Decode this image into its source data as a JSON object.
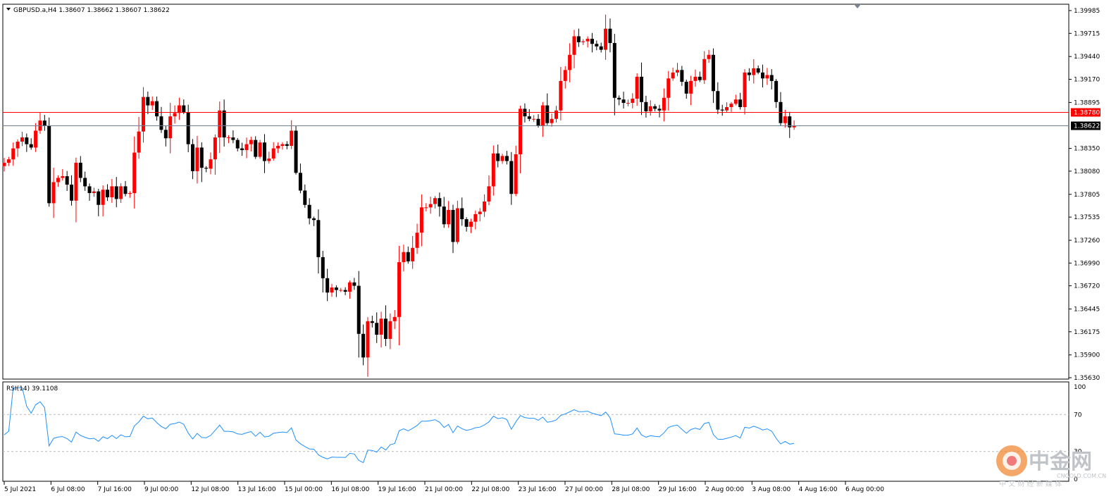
{
  "header": {
    "symbol_line": "GBPUSD.a,H4  1.38607 1.38662 1.38607 1.38622"
  },
  "colors": {
    "bull": "#ff0000",
    "bear": "#000000",
    "hline_red": "#ff0000",
    "hline_bid": "#708090",
    "rsi_line": "#1e90ff",
    "price_tag_red_bg": "#ff0000",
    "price_tag_dark_bg": "#000000"
  },
  "chart_data": {
    "type": "candlestick",
    "title": "GBPUSD.a,H4",
    "ohlc_header": [
      1.38607,
      1.38662,
      1.38607,
      1.38622
    ],
    "ylim": [
      1.3563,
      1.39985
    ],
    "price_ticks": [
      "1.39985",
      "1.39715",
      "1.39440",
      "1.39170",
      "1.38895",
      "1.38350",
      "1.38080",
      "1.37805",
      "1.37535",
      "1.37260",
      "1.36990",
      "1.36720",
      "1.36445",
      "1.36175",
      "1.35900",
      "1.35630"
    ],
    "horizontal_lines": [
      {
        "price": 1.3878,
        "label": "1.38780",
        "color": "red"
      },
      {
        "price": 1.38622,
        "label": "1.38622",
        "color": "bid"
      }
    ],
    "x_ticks": [
      "5 Jul 2021",
      "6 Jul 08:00",
      "7 Jul 16:00",
      "9 Jul 00:00",
      "12 Jul 08:00",
      "13 Jul 16:00",
      "15 Jul 00:00",
      "16 Jul 08:00",
      "19 Jul 16:00",
      "21 Jul 00:00",
      "22 Jul 08:00",
      "23 Jul 16:00",
      "27 Jul 00:00",
      "28 Jul 08:00",
      "29 Jul 16:00",
      "2 Aug 00:00",
      "3 Aug 08:00",
      "4 Aug 16:00",
      "6 Aug 00:00"
    ],
    "closes": [
      1.3818,
      1.3822,
      1.3835,
      1.3843,
      1.3848,
      1.384,
      1.3836,
      1.3856,
      1.3868,
      1.3862,
      1.377,
      1.3795,
      1.38,
      1.3802,
      1.3792,
      1.3773,
      1.3818,
      1.38,
      1.379,
      1.3782,
      1.3784,
      1.3768,
      1.3786,
      1.3777,
      1.379,
      1.3775,
      1.379,
      1.3781,
      1.3782,
      1.383,
      1.3855,
      1.3896,
      1.3886,
      1.3891,
      1.3873,
      1.3857,
      1.3847,
      1.3873,
      1.3877,
      1.3886,
      1.3878,
      1.384,
      1.3808,
      1.3836,
      1.3812,
      1.3811,
      1.3822,
      1.3848,
      1.388,
      1.3848,
      1.3848,
      1.3845,
      1.3835,
      1.3833,
      1.384,
      1.3845,
      1.3825,
      1.3842,
      1.382,
      1.3823,
      1.3835,
      1.3838,
      1.384,
      1.3838,
      1.3856,
      1.3806,
      1.3785,
      1.3768,
      1.3752,
      1.375,
      1.3706,
      1.3681,
      1.3664,
      1.367,
      1.3667,
      1.3667,
      1.3665,
      1.3676,
      1.3672,
      1.3615,
      1.3587,
      1.363,
      1.3628,
      1.3614,
      1.3633,
      1.3609,
      1.363,
      1.3635,
      1.37,
      1.3712,
      1.3701,
      1.3717,
      1.3735,
      1.3765,
      1.3765,
      1.3769,
      1.3776,
      1.3766,
      1.3745,
      1.3762,
      1.3724,
      1.3764,
      1.3751,
      1.3742,
      1.3748,
      1.3757,
      1.376,
      1.3772,
      1.379,
      1.3829,
      1.382,
      1.3826,
      1.382,
      1.3781,
      1.3828,
      1.3882,
      1.3873,
      1.387,
      1.387,
      1.3862,
      1.3886,
      1.3865,
      1.387,
      1.388,
      1.3915,
      1.3928,
      1.3946,
      1.3968,
      1.3961,
      1.3962,
      1.3965,
      1.3959,
      1.3956,
      1.3952,
      1.3977,
      1.396,
      1.3895,
      1.3893,
      1.3889,
      1.3889,
      1.3894,
      1.392,
      1.389,
      1.3879,
      1.3885,
      1.3882,
      1.388,
      1.3895,
      1.3918,
      1.3925,
      1.3928,
      1.3914,
      1.39,
      1.3915,
      1.392,
      1.3916,
      1.3941,
      1.3946,
      1.3903,
      1.3881,
      1.388,
      1.3884,
      1.3888,
      1.3893,
      1.3884,
      1.3925,
      1.3922,
      1.393,
      1.3925,
      1.3918,
      1.3922,
      1.3915,
      1.389,
      1.3865,
      1.3873,
      1.386,
      1.38622
    ],
    "rsi": {
      "label": "RSI(14) 39.1108",
      "period": 14,
      "last": 39.1108,
      "ylim": [
        0,
        100
      ],
      "levels": [
        70,
        30
      ],
      "ticks": [
        "100",
        "70",
        "30",
        "0"
      ]
    }
  },
  "watermark": {
    "logo_text": "中金网",
    "domain": "CNGOLD.COM.CN",
    "tagline": "中 文 财 经 新 媒 体"
  }
}
